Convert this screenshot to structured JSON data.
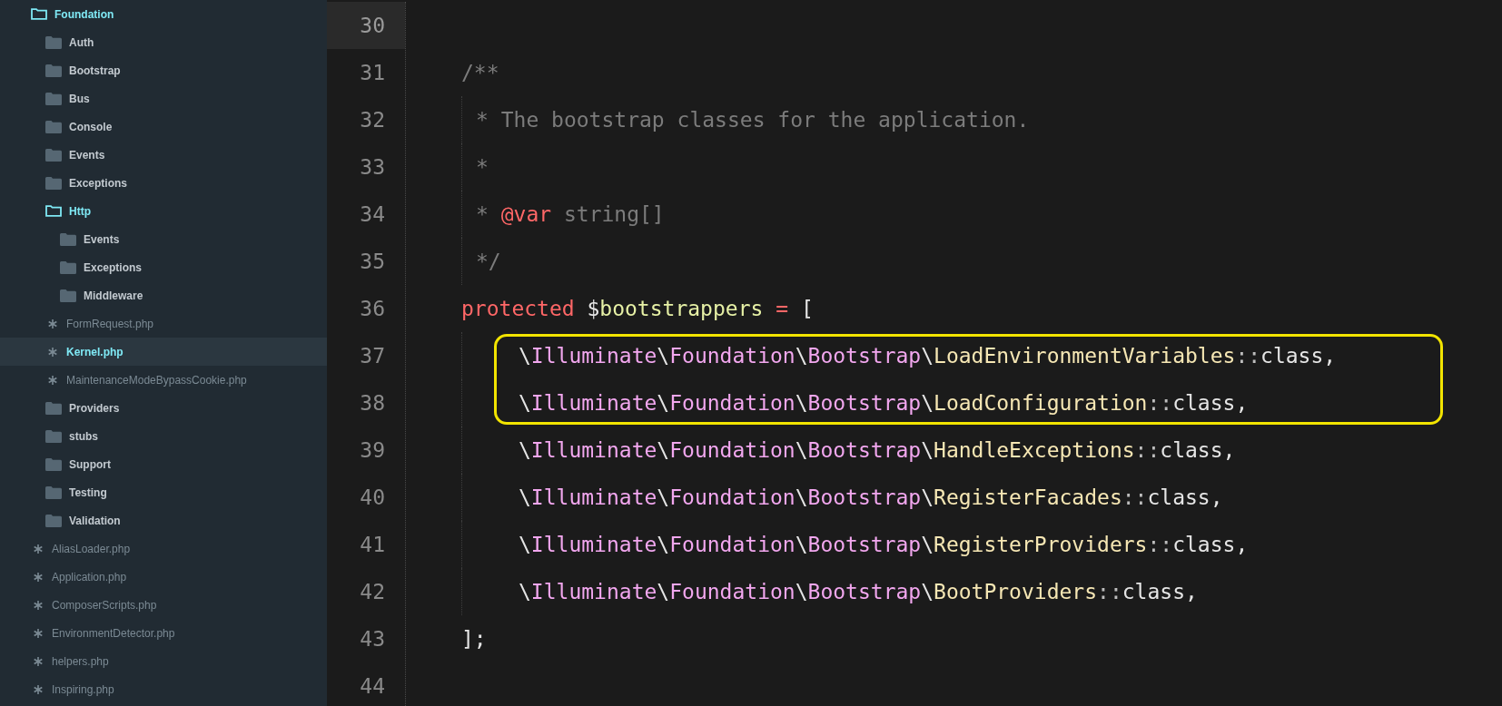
{
  "sidebar": {
    "tree": [
      {
        "name": "Foundation",
        "kind": "folder",
        "expanded": true,
        "selected": false,
        "children": [
          {
            "name": "Auth",
            "kind": "folder",
            "expanded": false,
            "selected": false
          },
          {
            "name": "Bootstrap",
            "kind": "folder",
            "expanded": false,
            "selected": false
          },
          {
            "name": "Bus",
            "kind": "folder",
            "expanded": false,
            "selected": false
          },
          {
            "name": "Console",
            "kind": "folder",
            "expanded": false,
            "selected": false
          },
          {
            "name": "Events",
            "kind": "folder",
            "expanded": false,
            "selected": false
          },
          {
            "name": "Exceptions",
            "kind": "folder",
            "expanded": false,
            "selected": false
          },
          {
            "name": "Http",
            "kind": "folder",
            "expanded": true,
            "selected": false,
            "children": [
              {
                "name": "Events",
                "kind": "folder",
                "expanded": false,
                "selected": false
              },
              {
                "name": "Exceptions",
                "kind": "folder",
                "expanded": false,
                "selected": false
              },
              {
                "name": "Middleware",
                "kind": "folder",
                "expanded": false,
                "selected": false
              },
              {
                "name": "FormRequest.php",
                "kind": "file",
                "selected": false
              },
              {
                "name": "Kernel.php",
                "kind": "file",
                "selected": true
              },
              {
                "name": "MaintenanceModeBypassCookie.php",
                "kind": "file",
                "selected": false
              }
            ]
          },
          {
            "name": "Providers",
            "kind": "folder",
            "expanded": false,
            "selected": false
          },
          {
            "name": "stubs",
            "kind": "folder",
            "expanded": false,
            "selected": false
          },
          {
            "name": "Support",
            "kind": "folder",
            "expanded": false,
            "selected": false
          },
          {
            "name": "Testing",
            "kind": "folder",
            "expanded": false,
            "selected": false
          },
          {
            "name": "Validation",
            "kind": "folder",
            "expanded": false,
            "selected": false
          },
          {
            "name": "AliasLoader.php",
            "kind": "file",
            "selected": false
          },
          {
            "name": "Application.php",
            "kind": "file",
            "selected": false
          },
          {
            "name": "ComposerScripts.php",
            "kind": "file",
            "selected": false
          },
          {
            "name": "EnvironmentDetector.php",
            "kind": "file",
            "selected": false
          },
          {
            "name": "helpers.php",
            "kind": "file",
            "selected": false
          },
          {
            "name": "Inspiring.php",
            "kind": "file",
            "selected": false
          }
        ]
      }
    ]
  },
  "editor": {
    "lines": [
      {
        "number": "30",
        "kind": "blank",
        "current": true,
        "highlighted": false
      },
      {
        "number": "31",
        "kind": "top",
        "current": false,
        "highlighted": false,
        "tokens": [
          {
            "t": "/**",
            "kind": "comment"
          }
        ]
      },
      {
        "number": "32",
        "kind": "doc",
        "current": false,
        "highlighted": false,
        "tokens": [
          {
            "t": "* The bootstrap classes for the application.",
            "kind": "comment"
          }
        ]
      },
      {
        "number": "33",
        "kind": "doc",
        "current": false,
        "highlighted": false,
        "tokens": [
          {
            "t": "*",
            "kind": "comment"
          }
        ]
      },
      {
        "number": "34",
        "kind": "doc",
        "current": false,
        "highlighted": false,
        "tokens": [
          {
            "t": "* ",
            "kind": "comment"
          },
          {
            "t": "@var",
            "kind": "keyword"
          },
          {
            "t": " string[]",
            "kind": "comment"
          }
        ]
      },
      {
        "number": "35",
        "kind": "doc",
        "current": false,
        "highlighted": false,
        "tokens": [
          {
            "t": "*/",
            "kind": "comment"
          }
        ]
      },
      {
        "number": "36",
        "kind": "top",
        "current": false,
        "highlighted": false,
        "tokens": [
          {
            "t": "protected",
            "kind": "keyword"
          },
          {
            "t": " $",
            "kind": "plain"
          },
          {
            "t": "bootstrappers",
            "kind": "variable"
          },
          {
            "t": " = ",
            "kind": "keyword"
          },
          {
            "t": "[",
            "kind": "plain"
          }
        ]
      },
      {
        "number": "37",
        "kind": "item",
        "current": false,
        "highlighted": true,
        "tokens": [
          {
            "t": "\\",
            "kind": "plain"
          },
          {
            "t": "Illuminate",
            "kind": "namespace"
          },
          {
            "t": "\\",
            "kind": "plain"
          },
          {
            "t": "Foundation",
            "kind": "namespace"
          },
          {
            "t": "\\",
            "kind": "plain"
          },
          {
            "t": "Bootstrap",
            "kind": "namespace"
          },
          {
            "t": "\\",
            "kind": "plain"
          },
          {
            "t": "LoadEnvironmentVariables",
            "kind": "class"
          },
          {
            "t": "::",
            "kind": "operator"
          },
          {
            "t": "class,",
            "kind": "plain"
          }
        ]
      },
      {
        "number": "38",
        "kind": "item",
        "current": false,
        "highlighted": true,
        "tokens": [
          {
            "t": "\\",
            "kind": "plain"
          },
          {
            "t": "Illuminate",
            "kind": "namespace"
          },
          {
            "t": "\\",
            "kind": "plain"
          },
          {
            "t": "Foundation",
            "kind": "namespace"
          },
          {
            "t": "\\",
            "kind": "plain"
          },
          {
            "t": "Bootstrap",
            "kind": "namespace"
          },
          {
            "t": "\\",
            "kind": "plain"
          },
          {
            "t": "LoadConfiguration",
            "kind": "class"
          },
          {
            "t": "::",
            "kind": "operator"
          },
          {
            "t": "class,",
            "kind": "plain"
          }
        ]
      },
      {
        "number": "39",
        "kind": "item",
        "current": false,
        "highlighted": false,
        "tokens": [
          {
            "t": "\\",
            "kind": "plain"
          },
          {
            "t": "Illuminate",
            "kind": "namespace"
          },
          {
            "t": "\\",
            "kind": "plain"
          },
          {
            "t": "Foundation",
            "kind": "namespace"
          },
          {
            "t": "\\",
            "kind": "plain"
          },
          {
            "t": "Bootstrap",
            "kind": "namespace"
          },
          {
            "t": "\\",
            "kind": "plain"
          },
          {
            "t": "HandleExceptions",
            "kind": "class"
          },
          {
            "t": "::",
            "kind": "operator"
          },
          {
            "t": "class,",
            "kind": "plain"
          }
        ]
      },
      {
        "number": "40",
        "kind": "item",
        "current": false,
        "highlighted": false,
        "tokens": [
          {
            "t": "\\",
            "kind": "plain"
          },
          {
            "t": "Illuminate",
            "kind": "namespace"
          },
          {
            "t": "\\",
            "kind": "plain"
          },
          {
            "t": "Foundation",
            "kind": "namespace"
          },
          {
            "t": "\\",
            "kind": "plain"
          },
          {
            "t": "Bootstrap",
            "kind": "namespace"
          },
          {
            "t": "\\",
            "kind": "plain"
          },
          {
            "t": "RegisterFacades",
            "kind": "class"
          },
          {
            "t": "::",
            "kind": "operator"
          },
          {
            "t": "class,",
            "kind": "plain"
          }
        ]
      },
      {
        "number": "41",
        "kind": "item",
        "current": false,
        "highlighted": false,
        "tokens": [
          {
            "t": "\\",
            "kind": "plain"
          },
          {
            "t": "Illuminate",
            "kind": "namespace"
          },
          {
            "t": "\\",
            "kind": "plain"
          },
          {
            "t": "Foundation",
            "kind": "namespace"
          },
          {
            "t": "\\",
            "kind": "plain"
          },
          {
            "t": "Bootstrap",
            "kind": "namespace"
          },
          {
            "t": "\\",
            "kind": "plain"
          },
          {
            "t": "RegisterProviders",
            "kind": "class"
          },
          {
            "t": "::",
            "kind": "operator"
          },
          {
            "t": "class,",
            "kind": "plain"
          }
        ]
      },
      {
        "number": "42",
        "kind": "item",
        "current": false,
        "highlighted": false,
        "tokens": [
          {
            "t": "\\",
            "kind": "plain"
          },
          {
            "t": "Illuminate",
            "kind": "namespace"
          },
          {
            "t": "\\",
            "kind": "plain"
          },
          {
            "t": "Foundation",
            "kind": "namespace"
          },
          {
            "t": "\\",
            "kind": "plain"
          },
          {
            "t": "Bootstrap",
            "kind": "namespace"
          },
          {
            "t": "\\",
            "kind": "plain"
          },
          {
            "t": "BootProviders",
            "kind": "class"
          },
          {
            "t": "::",
            "kind": "operator"
          },
          {
            "t": "class,",
            "kind": "plain"
          }
        ]
      },
      {
        "number": "43",
        "kind": "top",
        "current": false,
        "highlighted": false,
        "tokens": [
          {
            "t": "];",
            "kind": "plain"
          }
        ]
      },
      {
        "number": "44",
        "kind": "blank",
        "current": false,
        "highlighted": false
      }
    ]
  }
}
